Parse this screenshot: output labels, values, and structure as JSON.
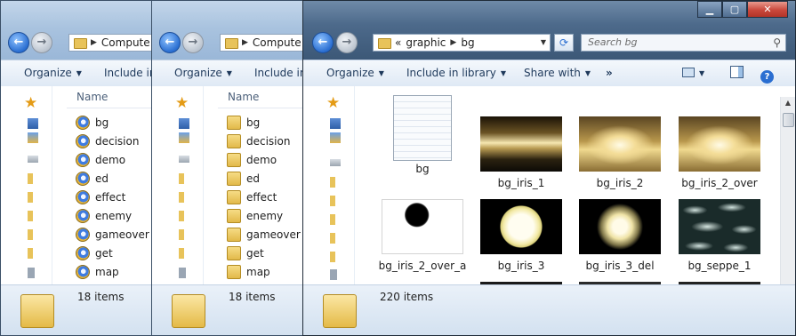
{
  "windows": {
    "back1": {
      "address": {
        "seg1": "Compute"
      },
      "toolbar": {
        "organize": "Organize",
        "include": "Include in"
      },
      "column_header": "Name",
      "files": [
        {
          "name": "bg",
          "type": "project"
        },
        {
          "name": "decision",
          "type": "project"
        },
        {
          "name": "demo",
          "type": "project"
        },
        {
          "name": "ed",
          "type": "project"
        },
        {
          "name": "effect",
          "type": "project"
        },
        {
          "name": "enemy",
          "type": "project"
        },
        {
          "name": "gameover",
          "type": "project"
        },
        {
          "name": "get",
          "type": "project"
        },
        {
          "name": "map",
          "type": "project"
        }
      ],
      "status": "18 items"
    },
    "back2": {
      "address": {
        "seg1": "Compute"
      },
      "toolbar": {
        "organize": "Organize",
        "include": "Include in"
      },
      "column_header": "Name",
      "files": [
        {
          "name": "bg",
          "type": "folder"
        },
        {
          "name": "decision",
          "type": "folder"
        },
        {
          "name": "demo",
          "type": "folder"
        },
        {
          "name": "ed",
          "type": "folder"
        },
        {
          "name": "effect",
          "type": "folder"
        },
        {
          "name": "enemy",
          "type": "folder"
        },
        {
          "name": "gameover",
          "type": "folder"
        },
        {
          "name": "get",
          "type": "folder"
        },
        {
          "name": "map",
          "type": "folder"
        }
      ],
      "status": "18 items"
    },
    "front": {
      "address": {
        "prefix": "«",
        "seg1": "graphic",
        "seg2": "bg"
      },
      "search_placeholder": "Search bg",
      "toolbar": {
        "organize": "Organize",
        "include": "Include in library",
        "share": "Share with",
        "more": "»"
      },
      "tiles": [
        {
          "label": "bg",
          "kind": "doc"
        },
        {
          "label": "bg_iris_1",
          "kind": "iris1"
        },
        {
          "label": "bg_iris_2",
          "kind": "iris2"
        },
        {
          "label": "bg_iris_2_over",
          "kind": "iris2"
        },
        {
          "label": "bg_iris_2_over_a",
          "kind": "dot"
        },
        {
          "label": "bg_iris_3",
          "kind": "sun"
        },
        {
          "label": "bg_iris_3_del",
          "kind": "blur"
        },
        {
          "label": "bg_seppe_1",
          "kind": "clouds"
        }
      ],
      "status": "220 items"
    }
  },
  "caption_buttons": {
    "min": "▁",
    "max": "▢",
    "close": "✕"
  },
  "colors": {
    "accent": "#2a6ed1",
    "close": "#c9483c",
    "folder": "#e8c35a"
  }
}
